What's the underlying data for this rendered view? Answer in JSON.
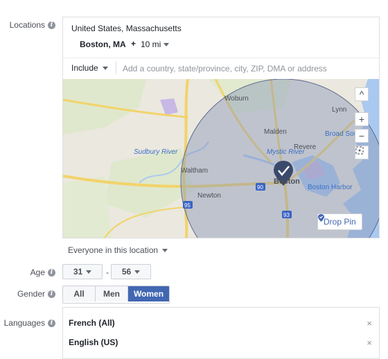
{
  "labels": {
    "locations": "Locations",
    "age": "Age",
    "gender": "Gender",
    "languages": "Languages"
  },
  "locations": {
    "country": "United States, Massachusetts",
    "city": "Boston, MA",
    "plus": "+",
    "radius": "10 mi",
    "include_mode": "Include",
    "search_placeholder": "Add a country, state/province, city, ZIP, DMA or address",
    "reach_option": "Everyone in this location"
  },
  "map": {
    "places": {
      "woburn": "Woburn",
      "lynn": "Lynn",
      "malden": "Malden",
      "revere": "Revere",
      "broad_sound": "Broad Sound",
      "sudbury_river": "Sudbury River",
      "mystic_river": "Mystic River",
      "waltham": "Waltham",
      "boston": "Boston",
      "boston_harbor": "Boston Harbor",
      "newton": "Newton"
    },
    "shields": {
      "i95_north": "95",
      "i95_south": "95",
      "i90": "90",
      "i93": "93"
    },
    "controls": {
      "zoom_in": "+",
      "zoom_out": "−",
      "collapse": "^"
    },
    "drop_pin_label": "Drop Pin",
    "colors": {
      "radius_fill": "#8a96b8",
      "pin": "#3b4a6b",
      "water": "#a9c9f1",
      "road": "#f2d36b"
    }
  },
  "age": {
    "min": "31",
    "dash": "-",
    "max": "56"
  },
  "gender": {
    "options": [
      "All",
      "Men",
      "Women"
    ],
    "selected": "Women"
  },
  "languages": {
    "items": [
      "French (All)",
      "English (US)"
    ],
    "remove_glyph": "×"
  }
}
